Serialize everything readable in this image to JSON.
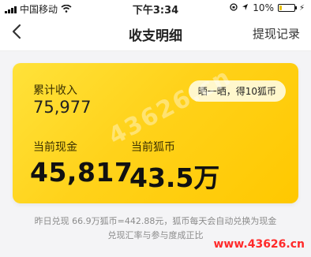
{
  "status_bar": {
    "carrier": "中国移动",
    "time": "下午3:34",
    "battery_percent": "10%"
  },
  "nav": {
    "back_icon": "chevron-left-icon",
    "title": "收支明细",
    "right_link": "提现记录"
  },
  "card": {
    "accum_label": "累计收入",
    "accum_value": "75,977",
    "share_button": "晒一晒，得10狐币",
    "cash_label": "当前现金",
    "cash_value": "45,817",
    "coin_label": "当前狐币",
    "coin_value": "43.5万"
  },
  "notes": {
    "line1": "昨日兑现 66.9万狐币=442.88元，狐币每天会自动兑换为现金",
    "line2": "兑现汇率与参与度成正比"
  },
  "watermark": {
    "center": "43626.cn",
    "bottom_right": "www.43626.cn"
  },
  "colors": {
    "card_start": "#ffe23a",
    "card_end": "#ffc800",
    "watermark_red": "#ff2a2a"
  }
}
